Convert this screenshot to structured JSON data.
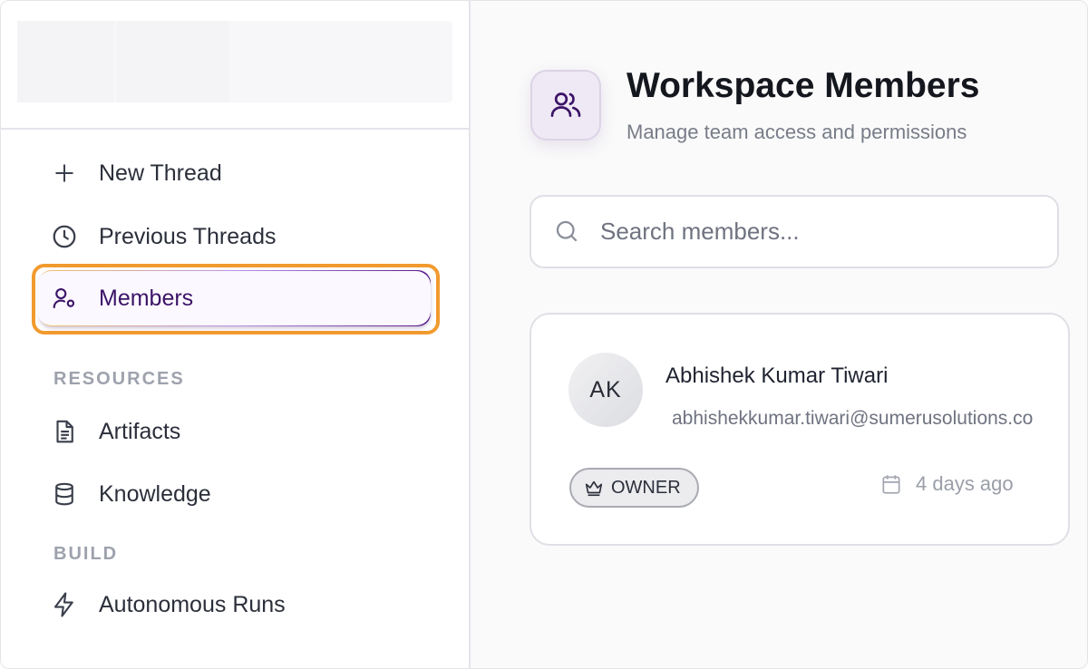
{
  "sidebar": {
    "nav": [
      {
        "label": "New Thread",
        "icon": "plus-icon"
      },
      {
        "label": "Previous Threads",
        "icon": "clock-icon"
      },
      {
        "label": "Members",
        "icon": "user-cog-icon",
        "active": true
      }
    ],
    "sections": [
      {
        "label": "RESOURCES",
        "items": [
          {
            "label": "Artifacts",
            "icon": "file-text-icon"
          },
          {
            "label": "Knowledge",
            "icon": "database-icon"
          }
        ]
      },
      {
        "label": "BUILD",
        "items": [
          {
            "label": "Autonomous Runs",
            "icon": "lightning-icon"
          }
        ]
      }
    ]
  },
  "header": {
    "title": "Workspace Members",
    "subtitle": "Manage team access and permissions",
    "icon": "users-icon"
  },
  "search": {
    "placeholder": "Search members..."
  },
  "members": [
    {
      "initials": "AK",
      "name": "Abhishek Kumar Tiwari",
      "email": "abhishekkumar.tiwari@sumerusolutions.com",
      "role": "OWNER",
      "role_icon": "crown-icon",
      "joined": "4 days ago"
    }
  ],
  "colors": {
    "accent": "#3b1467",
    "highlight_ring": "#f19a2e"
  }
}
